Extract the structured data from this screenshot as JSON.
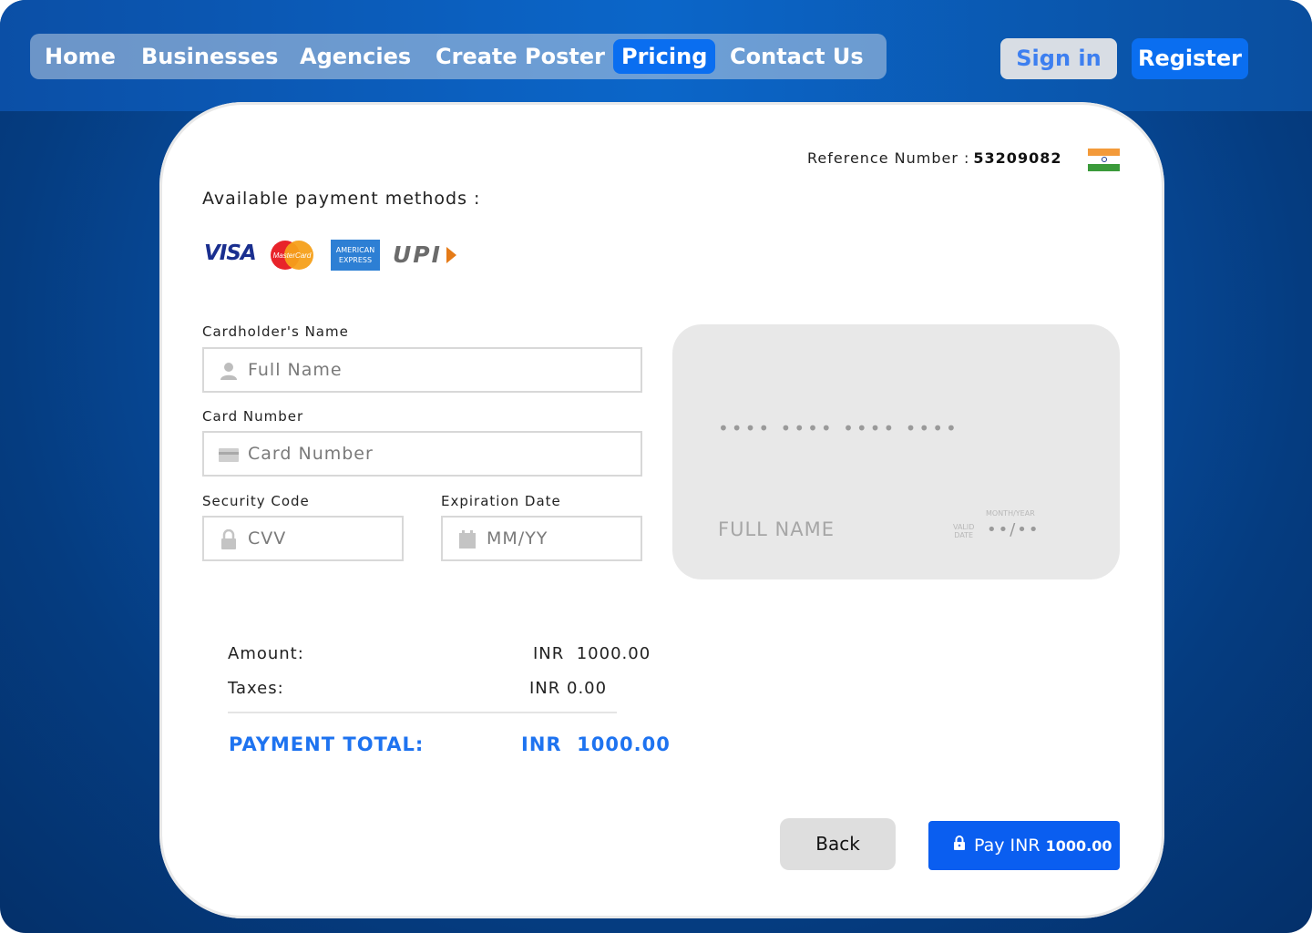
{
  "nav": {
    "items": [
      {
        "label": "Home",
        "active": false
      },
      {
        "label": "Businesses",
        "active": false
      },
      {
        "label": "Agencies",
        "active": false
      },
      {
        "label": "Create Poster",
        "active": false
      },
      {
        "label": "Pricing",
        "active": true
      },
      {
        "label": "Contact Us",
        "active": false
      }
    ],
    "signin_label": "Sign in",
    "register_label": "Register"
  },
  "payment": {
    "reference_label": "Reference Number :",
    "reference_number": "53209082",
    "flag": "india-flag",
    "available_methods_label": "Available payment methods :",
    "methods": {
      "visa": "VISA",
      "mastercard": "MasterCard",
      "amex_line1": "AMERICAN",
      "amex_line2": "EXPRESS",
      "upi": "UPI"
    }
  },
  "form": {
    "name_label": "Cardholder's Name",
    "name_placeholder": "Full Name",
    "card_label": "Card Number",
    "card_placeholder": "Card Number",
    "cvv_label": "Security Code",
    "cvv_placeholder": "CVV",
    "exp_label": "Expiration Date",
    "exp_placeholder": "MM/YY"
  },
  "card_preview": {
    "number": "•••• •••• •••• ••••",
    "name": "FULL NAME",
    "month_year_label": "MONTH/YEAR",
    "valid_label_1": "VALID",
    "valid_label_2": "DATE",
    "expiry": "••/••"
  },
  "summary": {
    "amount_label": "Amount:",
    "amount_value": "INR  1000.00",
    "taxes_label": "Taxes:",
    "taxes_value": "INR 0.00",
    "total_label": "PAYMENT TOTAL:",
    "total_value": "INR  1000.00"
  },
  "actions": {
    "back_label": "Back",
    "pay_label": "Pay INR",
    "pay_amount": "1000.00"
  },
  "colors": {
    "accent": "#0a6ef0",
    "total_blue": "#1e73f0"
  }
}
